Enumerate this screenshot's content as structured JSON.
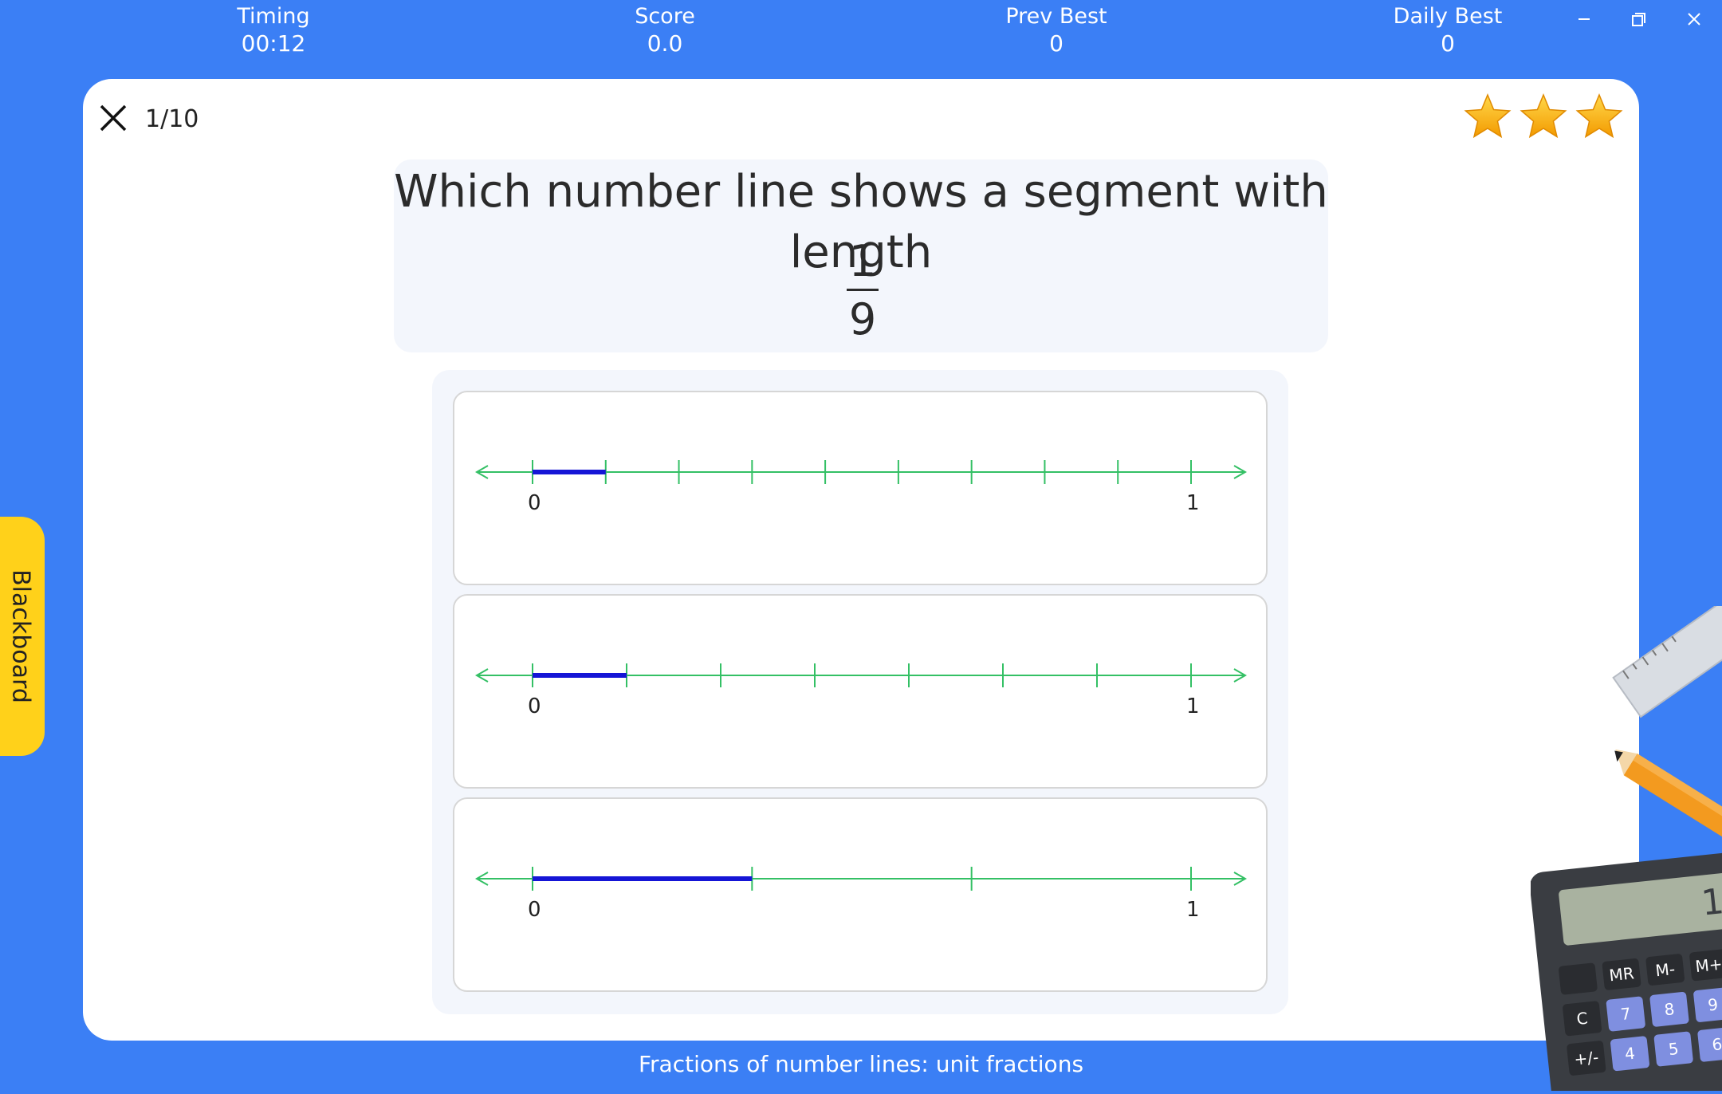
{
  "header": {
    "timing": {
      "label": "Timing",
      "value": "00:12"
    },
    "score": {
      "label": "Score",
      "value": "0.0"
    },
    "prev_best": {
      "label": "Prev Best",
      "value": "0"
    },
    "daily_best": {
      "label": "Daily Best",
      "value": "0"
    }
  },
  "window_controls": [
    "minimize-icon",
    "restore-icon",
    "close-icon"
  ],
  "quiz": {
    "progress": "1/10",
    "stars_count": 3,
    "question": "Which number line shows a segment with length",
    "fraction": {
      "numerator": "1",
      "denominator": "9"
    },
    "options": [
      {
        "divisions": 9,
        "highlight_parts": 1,
        "start_label": "0",
        "end_label": "1"
      },
      {
        "divisions": 7,
        "highlight_parts": 1,
        "start_label": "0",
        "end_label": "1"
      },
      {
        "divisions": 3,
        "highlight_parts": 1,
        "start_label": "0",
        "end_label": "1"
      }
    ]
  },
  "sidebar": {
    "blackboard_label": "Blackboard"
  },
  "footer": {
    "topic": "Fractions of number lines: unit fractions"
  },
  "colors": {
    "background": "#3b7ff5",
    "line": "#34c065",
    "segment": "#1515d6",
    "tab": "#ffd11a",
    "star": "#f7b500"
  }
}
